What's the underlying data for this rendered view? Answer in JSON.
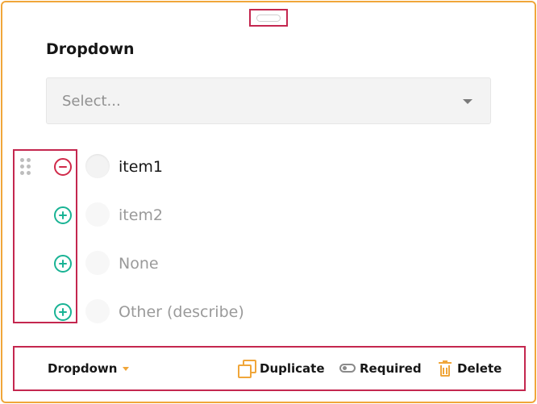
{
  "question": {
    "title": "Dropdown",
    "placeholder": "Select..."
  },
  "choices": [
    {
      "label": "item1",
      "action": "remove"
    },
    {
      "label": "item2",
      "action": "add"
    },
    {
      "label": "None",
      "action": "add"
    },
    {
      "label": "Other (describe)",
      "action": "add"
    }
  ],
  "toolbar": {
    "type_label": "Dropdown",
    "duplicate_label": "Duplicate",
    "required_label": "Required",
    "delete_label": "Delete"
  },
  "icons": {
    "drag_top": "drag-handle-icon",
    "drag_row": "drag-dots-icon",
    "remove": "minus-circle-icon",
    "add": "plus-circle-icon",
    "select_caret": "chevron-down-icon",
    "type_caret": "caret-down-icon",
    "duplicate": "duplicate-icon",
    "required": "toggle-icon",
    "delete": "trash-icon"
  },
  "colors": {
    "accent": "#f0a63a",
    "selection_outline": "#c4274f",
    "add": "#19b394",
    "remove": "#d02a4a"
  }
}
